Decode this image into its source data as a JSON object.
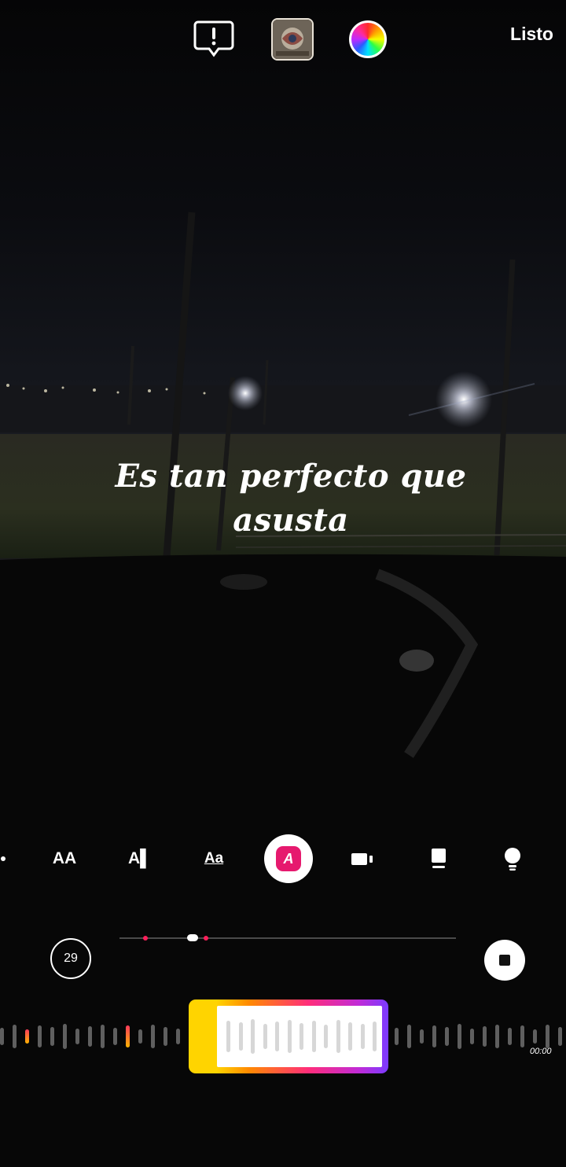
{
  "header": {
    "warning_icon": "exclamation-bubble-icon",
    "thumbnail_icon": "sticker-thumbnail",
    "color_icon": "color-wheel-icon",
    "done_label": "Listo"
  },
  "caption": {
    "line1": "Es tan perfecto que",
    "line2": "asusta"
  },
  "style_toolbar": {
    "items": [
      {
        "icon": "font-size-icon",
        "label": "AA"
      },
      {
        "icon": "text-background-icon",
        "label": "A▌"
      },
      {
        "icon": "underline-text-icon",
        "label": "Aa"
      },
      {
        "icon": "text-effect-a-icon",
        "label": "A"
      },
      {
        "icon": "camera-icon",
        "label": ""
      },
      {
        "icon": "card-icon",
        "label": ""
      },
      {
        "icon": "lightbulb-icon",
        "label": ""
      }
    ]
  },
  "timeline": {
    "clip_count": "29",
    "stop_icon": "stop-icon",
    "position_fraction": 0.2
  },
  "audio": {
    "time_label": "00:00"
  },
  "colors": {
    "accent": "#e6196e",
    "selector_gradient": [
      "#ffd400",
      "#ff8a00",
      "#ff2d7a",
      "#7b3bff"
    ]
  }
}
